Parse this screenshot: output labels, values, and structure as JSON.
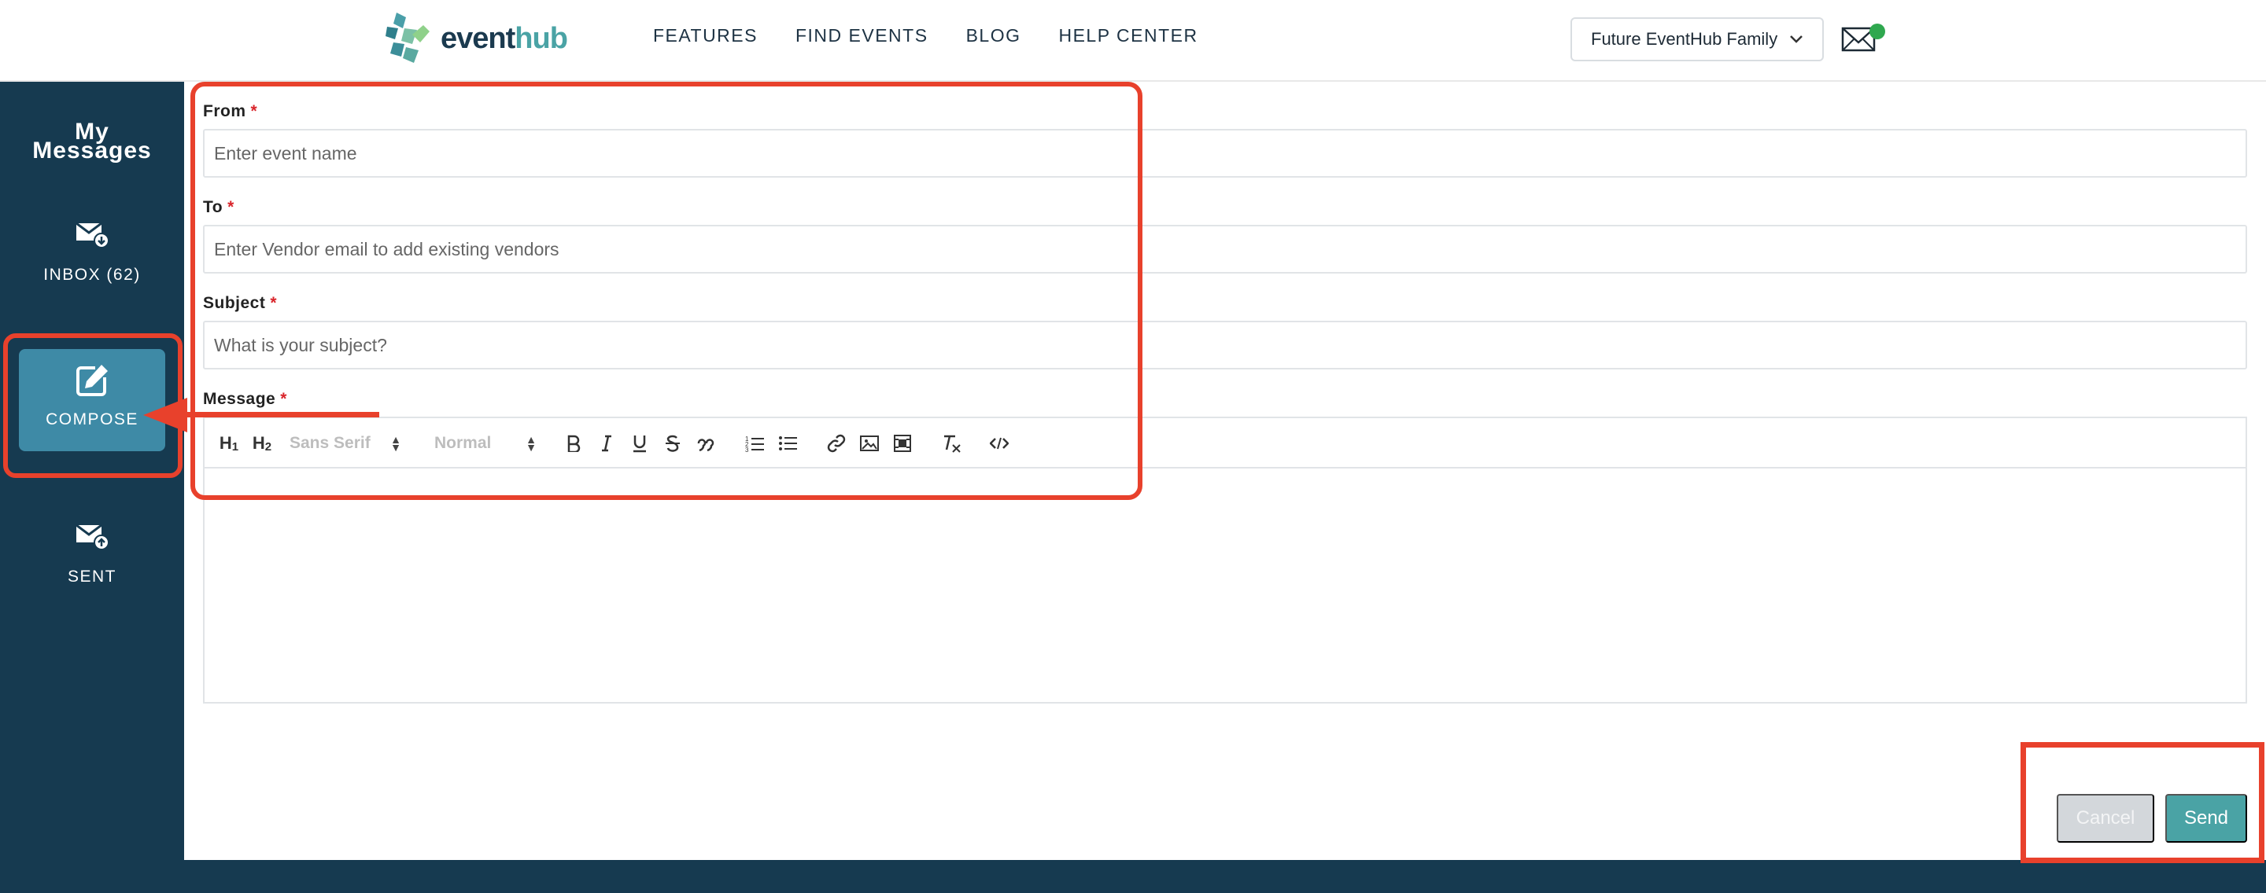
{
  "brand": {
    "name_part1": "event",
    "name_part2": "hub"
  },
  "nav": {
    "items": [
      "FEATURES",
      "FIND EVENTS",
      "BLOG",
      "HELP CENTER"
    ]
  },
  "account": {
    "name": "Future EventHub Family"
  },
  "sidebar": {
    "title_line1": "My",
    "title_line2": "Messages",
    "items": [
      {
        "label": "INBOX (62)",
        "icon": "inbox-icon"
      },
      {
        "label": "COMPOSE",
        "icon": "compose-icon",
        "active": true
      },
      {
        "label": "SENT",
        "icon": "sent-icon"
      }
    ]
  },
  "form": {
    "from": {
      "label": "From",
      "placeholder": "Enter event name"
    },
    "to": {
      "label": "To",
      "placeholder": "Enter Vendor email to add existing vendors"
    },
    "subject": {
      "label": "Subject",
      "placeholder": "What is your subject?"
    },
    "message": {
      "label": "Message"
    },
    "required_mark": "*"
  },
  "toolbar": {
    "h1": "H1",
    "h2": "H2",
    "font": "Sans Serif",
    "size": "Normal"
  },
  "actions": {
    "cancel": "Cancel",
    "send": "Send"
  },
  "colors": {
    "accent": "#4aa3a5",
    "sidebar": "#163a50",
    "active": "#3e8aa6",
    "annotation": "#e8412c"
  }
}
